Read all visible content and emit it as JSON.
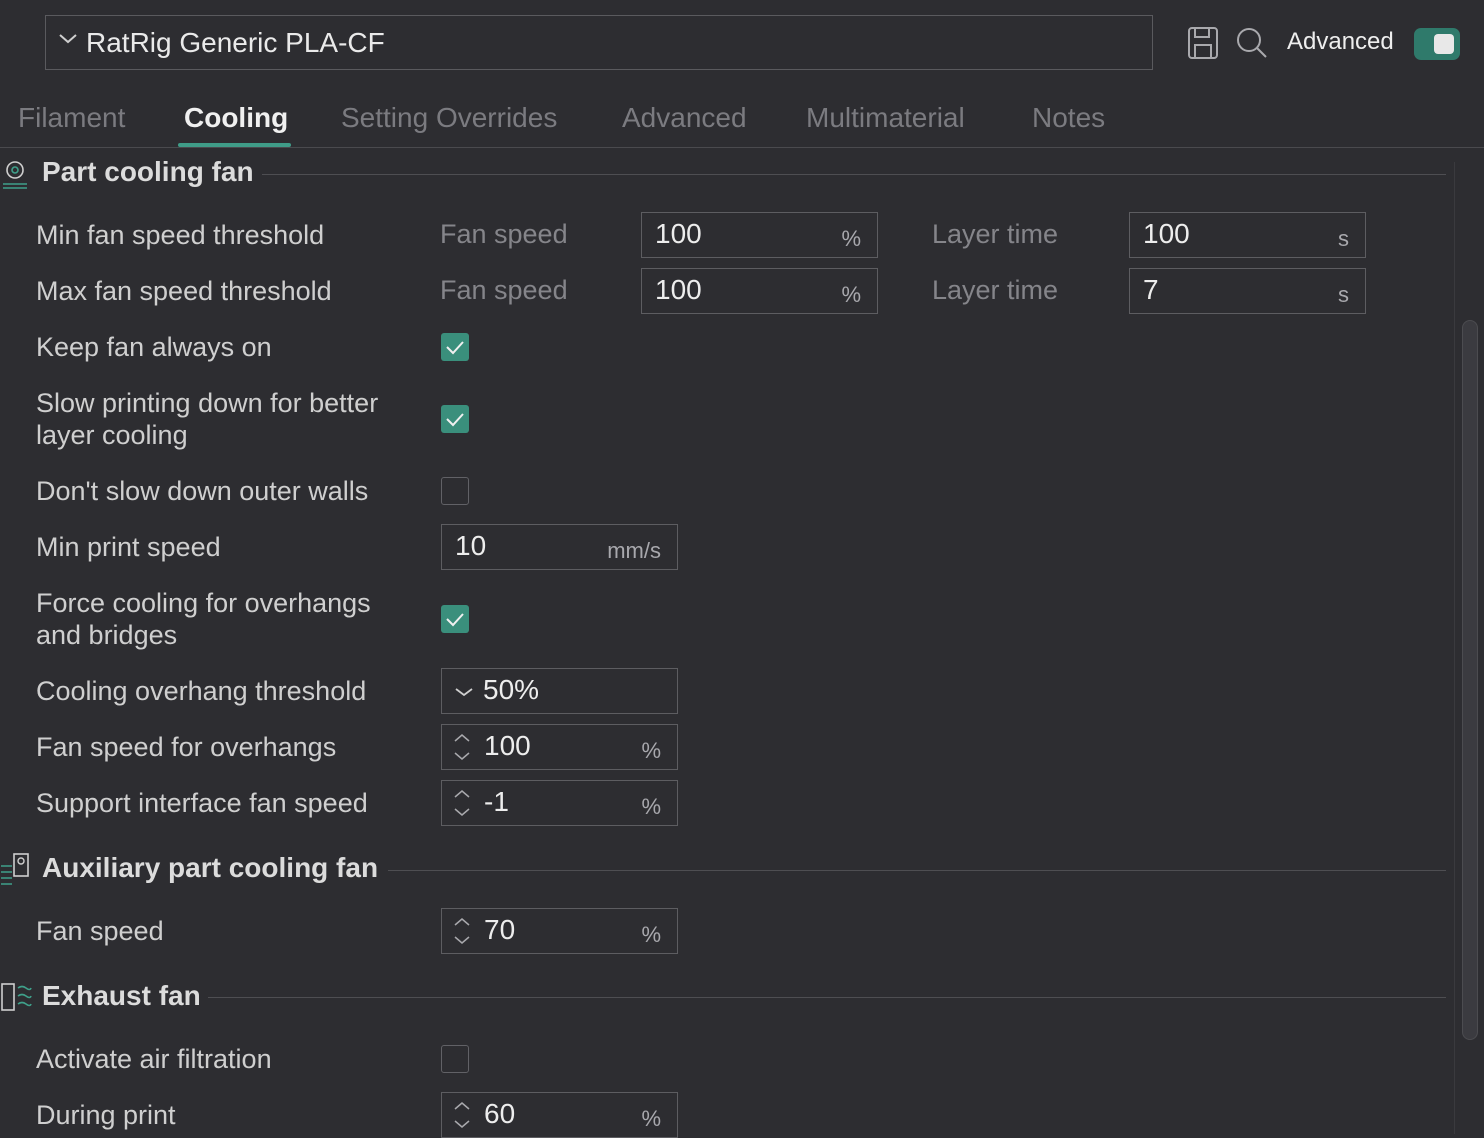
{
  "header": {
    "preset_name": "RatRig Generic PLA-CF",
    "advanced_label": "Advanced",
    "advanced_toggle_on": true,
    "icons": [
      "chevron-down-icon",
      "save-icon",
      "search-icon"
    ]
  },
  "tabs": [
    {
      "label": "Filament",
      "active": false
    },
    {
      "label": "Cooling",
      "active": true
    },
    {
      "label": "Setting Overrides",
      "active": false
    },
    {
      "label": "Advanced",
      "active": false
    },
    {
      "label": "Multimaterial",
      "active": false
    },
    {
      "label": "Notes",
      "active": false
    }
  ],
  "part_cooling": {
    "title": "Part cooling fan",
    "min_threshold": {
      "label": "Min fan speed threshold",
      "fan_label": "Fan speed",
      "fan_value": "100",
      "fan_unit": "%",
      "layer_label": "Layer time",
      "layer_value": "100",
      "layer_unit": "s"
    },
    "max_threshold": {
      "label": "Max fan speed threshold",
      "fan_label": "Fan speed",
      "fan_value": "100",
      "fan_unit": "%",
      "layer_label": "Layer time",
      "layer_value": "7",
      "layer_unit": "s"
    },
    "keep_fan_on": {
      "label": "Keep fan always on",
      "checked": true
    },
    "slow_down": {
      "label_line1": "Slow printing down for better",
      "label_line2": "layer cooling",
      "checked": true
    },
    "dont_slow_walls": {
      "label": "Don't slow down outer walls",
      "checked": false
    },
    "min_print_speed": {
      "label": "Min print speed",
      "value": "10",
      "unit": "mm/s"
    },
    "force_cooling": {
      "label_line1": "Force cooling for overhangs",
      "label_line2": "and bridges",
      "checked": true
    },
    "overhang_threshold": {
      "label": "Cooling overhang threshold",
      "value": "50%"
    },
    "fan_overhangs": {
      "label": "Fan speed for overhangs",
      "value": "100",
      "unit": "%"
    },
    "support_interface": {
      "label": "Support interface fan speed",
      "value": "-1",
      "unit": "%"
    }
  },
  "aux_fan": {
    "title": "Auxiliary part cooling fan",
    "fan_speed": {
      "label": "Fan speed",
      "value": "70",
      "unit": "%"
    }
  },
  "exhaust_fan": {
    "title": "Exhaust fan",
    "air_filtration": {
      "label": "Activate air filtration",
      "checked": false
    },
    "during_print": {
      "label": "During print",
      "value": "60",
      "unit": "%"
    }
  },
  "colors": {
    "accent": "#3a8f7c",
    "background": "#2d2d31"
  }
}
